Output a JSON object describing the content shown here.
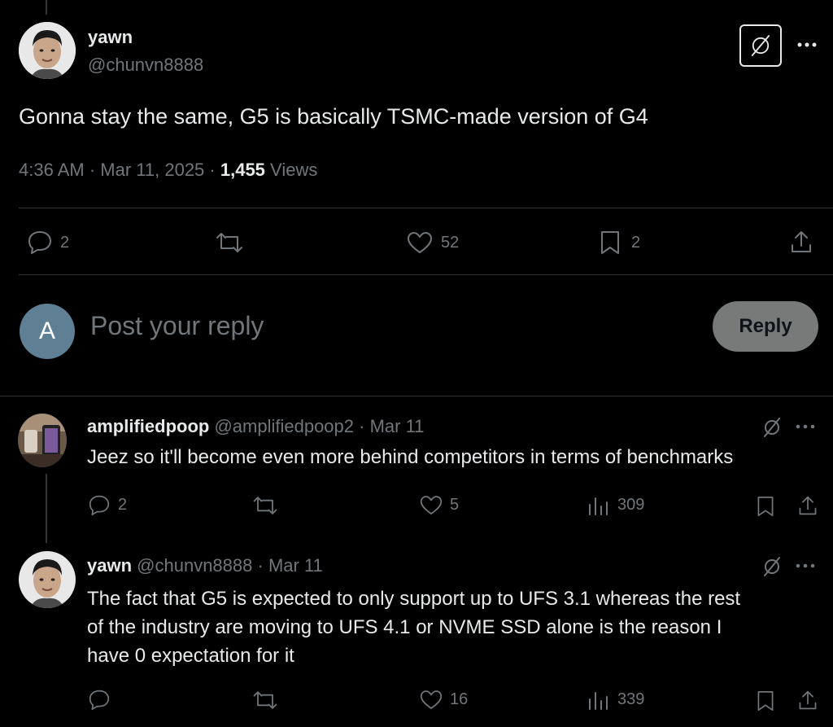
{
  "main_post": {
    "display_name": "yawn",
    "handle": "@chunvn8888",
    "text": "Gonna stay the same, G5 is basically TSMC-made version of G4",
    "time": "4:36 AM",
    "date": "Mar 11, 2025",
    "views_count": "1,455",
    "views_label": "Views",
    "replies": "2",
    "likes": "52",
    "bookmarks": "2",
    "meta_sep": " · "
  },
  "composer": {
    "avatar_letter": "A",
    "placeholder": "Post your reply",
    "reply_button": "Reply"
  },
  "replies": [
    {
      "display_name": "amplifiedpoop",
      "handle": "@amplifiedpoop2",
      "date": "Mar 11",
      "text": "Jeez so it'll become even more behind competitors in terms of benchmarks",
      "replies": "2",
      "retweets": "",
      "likes": "5",
      "views": "309"
    },
    {
      "display_name": "yawn",
      "handle": "@chunvn8888",
      "date": "Mar 11",
      "text_lines": [
        "The fact that G5 is expected to only support up to UFS 3.1 whereas the rest",
        "of the industry are moving to UFS 4.1 or NVME SSD alone is the reason I",
        "have 0 expectation for it"
      ],
      "replies": "",
      "retweets": "",
      "likes": "16",
      "views": "339"
    }
  ],
  "colors": {
    "background": "#000000",
    "text": "#e7e9ea",
    "muted": "#71767b",
    "divider": "#2f3336",
    "reply_button_bg": "#787a7a",
    "composer_avatar_bg": "#5f7f95"
  }
}
